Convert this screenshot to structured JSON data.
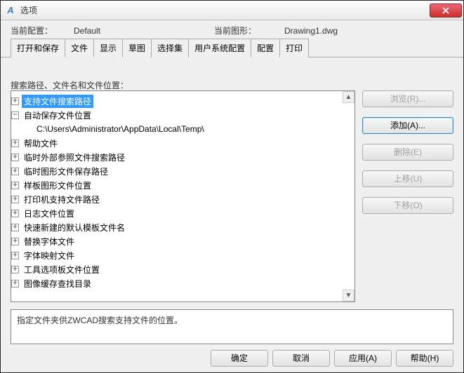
{
  "window": {
    "title": "选项"
  },
  "info": {
    "current_config_label": "当前配置：",
    "current_config_value": "Default",
    "current_drawing_label": "当前图形：",
    "current_drawing_value": "Drawing1.dwg"
  },
  "tabs": {
    "items": [
      {
        "label": "打开和保存"
      },
      {
        "label": "文件"
      },
      {
        "label": "显示"
      },
      {
        "label": "草图"
      },
      {
        "label": "选择集"
      },
      {
        "label": "用户系统配置"
      },
      {
        "label": "配置"
      },
      {
        "label": "打印"
      }
    ],
    "active_index": 1
  },
  "files_tab": {
    "group_label": "搜索路径、文件名和文件位置：",
    "tree": [
      {
        "label": "支持文件搜索路径",
        "expanded": false,
        "selected": true
      },
      {
        "label": "自动保存文件位置",
        "expanded": true,
        "children": [
          {
            "label": "C:\\Users\\Administrator\\AppData\\Local\\Temp\\"
          }
        ]
      },
      {
        "label": "帮助文件",
        "expanded": false
      },
      {
        "label": "临时外部参照文件搜索路径",
        "expanded": false
      },
      {
        "label": "临时图形文件保存路径",
        "expanded": false
      },
      {
        "label": "样板图形文件位置",
        "expanded": false
      },
      {
        "label": "打印机支持文件路径",
        "expanded": false
      },
      {
        "label": "日志文件位置",
        "expanded": false
      },
      {
        "label": "快速新建的默认模板文件名",
        "expanded": false
      },
      {
        "label": "替换字体文件",
        "expanded": false
      },
      {
        "label": "字体映射文件",
        "expanded": false
      },
      {
        "label": "工具选项板文件位置",
        "expanded": false
      },
      {
        "label": "图像缓存查找目录",
        "expanded": false
      }
    ],
    "description": "指定文件夹供ZWCAD搜索支持文件的位置。",
    "buttons": {
      "browse": "浏览(R)...",
      "add": "添加(A)...",
      "remove": "删除(E)",
      "move_up": "上移(U)",
      "move_down": "下移(O)"
    }
  },
  "footer": {
    "ok": "确定",
    "cancel": "取消",
    "apply": "应用(A)",
    "help": "帮助(H)"
  }
}
